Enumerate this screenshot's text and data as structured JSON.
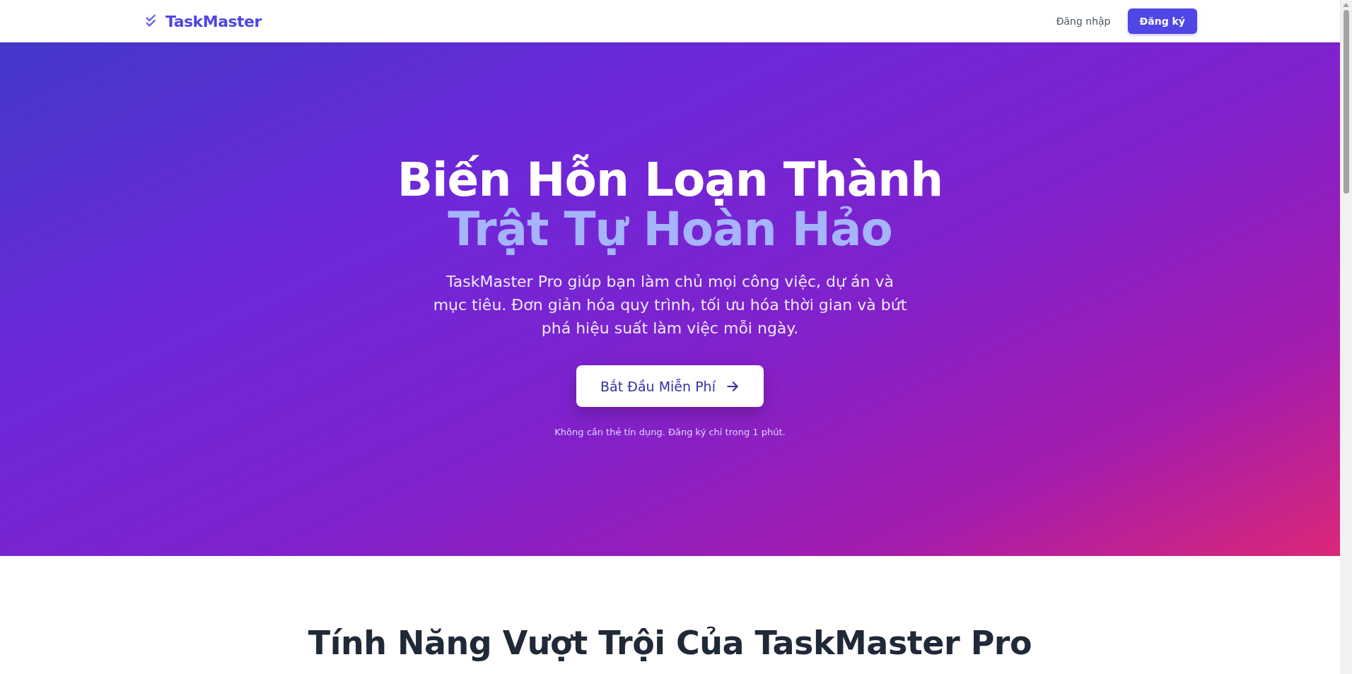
{
  "header": {
    "logo": "TaskMaster",
    "nav": [
      {
        "label": "Đăng nhập",
        "kind": "link"
      },
      {
        "label": "Đăng ký",
        "kind": "primary"
      }
    ]
  },
  "hero": {
    "title": "Biến Hỗn Loạn Thành",
    "title_highlight": "Trật Tự Hoàn Hảo",
    "description": "TaskMaster Pro giúp bạn làm chủ mọi công việc, dự án và mục tiêu. Đơn giản hóa quy trình, tối ưu hóa thời gian và bứt phá hiệu suất làm việc mỗi ngày.",
    "cta": "Bắt Đầu Miễn Phí",
    "note": "Không cần thẻ tín dụng. Đăng ký chỉ trong 1 phút."
  },
  "features": {
    "heading": "Tính Năng Vượt Trội Của TaskMaster Pro"
  }
}
